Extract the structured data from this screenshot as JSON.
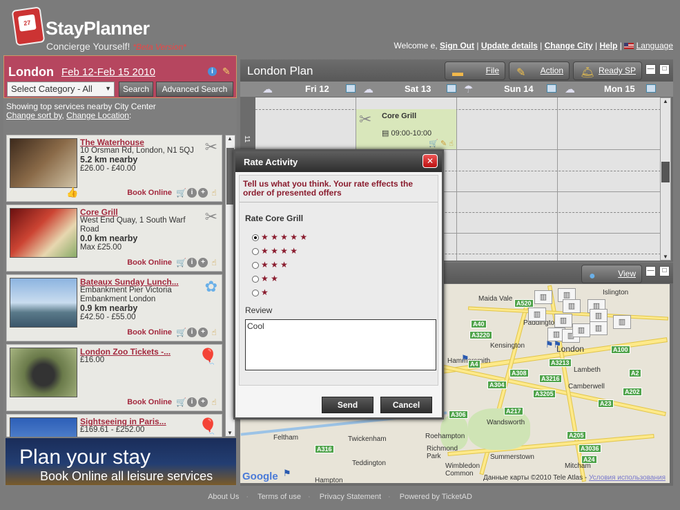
{
  "brand": {
    "name": "StayPlanner",
    "tagline": "Concierge Yourself!",
    "beta": "*Beta Version*",
    "calendar_day": "27"
  },
  "top": {
    "welcome": "Welcome e,",
    "sign_out": "Sign Out",
    "update": "Update details",
    "change_city": "Change City",
    "help": "Help",
    "language": "Language"
  },
  "city": {
    "name": "London",
    "dates": "Feb 12-Feb 15 2010",
    "category": "Select Category - All",
    "search": "Search",
    "advanced": "Advanced Search"
  },
  "showing": {
    "text": "Showing top services nearby City Center",
    "sort": "Change sort by",
    "location": "Change Location",
    "colon": ":"
  },
  "items": [
    {
      "title": "The Waterhouse",
      "addr": "10 Orsman Rd, London, N1 5QJ",
      "dist": "5.2 km nearby",
      "price": "£26.00 - £40.00",
      "book": "Book Online"
    },
    {
      "title": "Core Grill",
      "addr": "West End Quay, 1 South Warf Road",
      "dist": "0.0 km nearby",
      "price": "Max £25.00",
      "book": "Book Online"
    },
    {
      "title": "Bateaux Sunday Lunch...",
      "addr": "Embankment Pier Victoria Embankment London",
      "dist": "0.9 km nearby",
      "price": "£42.50 - £55.00",
      "book": "Book Online"
    },
    {
      "title": "London Zoo Tickets -...",
      "addr": "",
      "dist": "",
      "price": "£16.00",
      "book": "Book Online"
    },
    {
      "title": "Sightseeing in Paris...",
      "addr": "",
      "dist": "",
      "price": "£169.61 - £252.00",
      "book": ""
    }
  ],
  "banner": {
    "l1": "Plan your stay",
    "l2": "Book Online all leisure services"
  },
  "plan": {
    "title": "London Plan",
    "file": "File",
    "action": "Action",
    "ready": "Ready SP",
    "days": [
      "Fri 12",
      "Sat 13",
      "Sun 14",
      "Mon 15"
    ],
    "hour": "11"
  },
  "event": {
    "name": "Core Grill",
    "time": "09:00-10:00"
  },
  "map": {
    "view": "View",
    "attribution": "Данные карты ©2010 Tele Atlas -",
    "terms": "Условия использования",
    "google": "Google",
    "places": [
      "Islington",
      "Maida Vale",
      "Paddington",
      "Kensington",
      "Hammersmith",
      "London",
      "Lambeth",
      "Camberwell",
      "Wandsworth",
      "Feltham",
      "Twickenham",
      "Richmond Park",
      "Teddington",
      "Hampton",
      "Roehampton",
      "Summerstown",
      "Wimbledon Common",
      "Mitcham"
    ],
    "roads": [
      "A40",
      "A3220",
      "A4",
      "A308",
      "A3216",
      "A3213",
      "A205",
      "A2",
      "A202",
      "A100",
      "A306",
      "A217",
      "A24",
      "A316",
      "A520",
      "A304",
      "A3205",
      "A3036",
      "A23"
    ]
  },
  "modal": {
    "title": "Rate Activity",
    "close": "✕",
    "msg": "Tell us what you think. Your rate effects the order of presented offers",
    "rate": "Rate Core Grill",
    "review_label": "Review",
    "review": "Cool",
    "send": "Send",
    "cancel": "Cancel",
    "selected": 5
  },
  "footer": {
    "about": "About Us",
    "terms": "Terms of use",
    "privacy": "Privacy Statement",
    "powered": "Powered by TicketAD"
  },
  "colors": {
    "accent": "#b6465f",
    "title_red": "#a3283d",
    "panel": "#6c6c6c"
  }
}
